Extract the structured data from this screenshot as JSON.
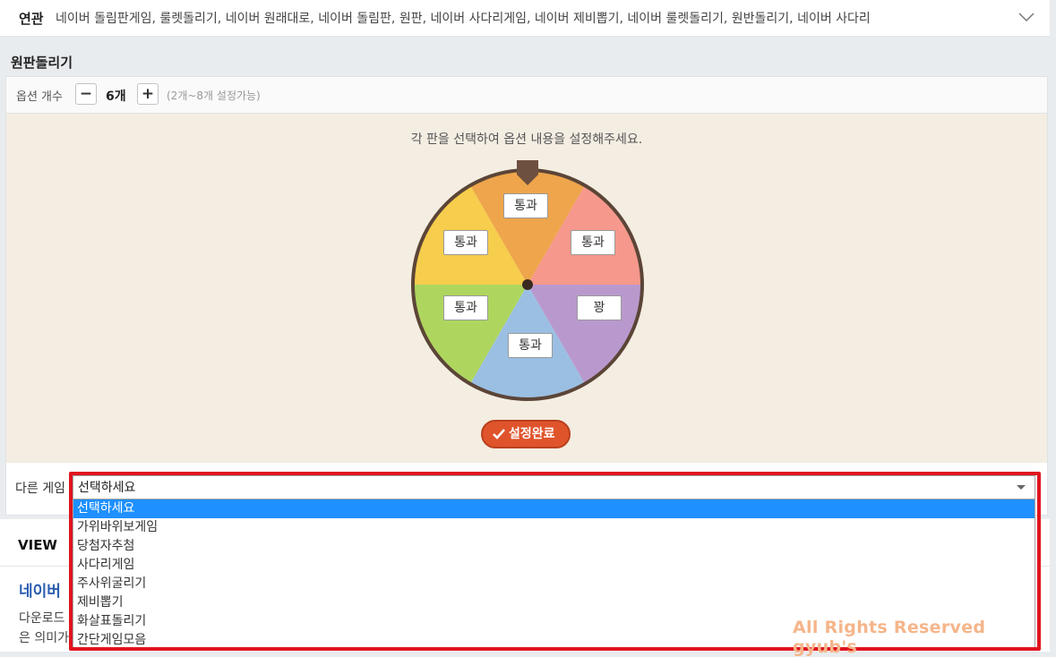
{
  "related": {
    "label": "연관",
    "keywords": "네이버 돌림판게임, 룰렛돌리기, 네이버 원래대로, 네이버 돌림판, 원판, 네이버 사다리게임, 네이버 제비뽑기, 네이버 룰렛돌리기, 원반돌리기, 네이버 사다리",
    "expand_icon": "chevron-down-icon"
  },
  "section_title": "원판돌리기",
  "options": {
    "label": "옵션 개수",
    "minus": "−",
    "plus": "+",
    "count": "6개",
    "range_hint": "(2개~8개 설정가능)"
  },
  "wheel": {
    "instruction": "각 판을 선택하여 옵션 내용을 설정해주세요.",
    "slices": [
      {
        "label": "통과",
        "color": "#eea54b"
      },
      {
        "label": "통과",
        "color": "#f6988c"
      },
      {
        "label": "꽝",
        "color": "#b999cd"
      },
      {
        "label": "통과",
        "color": "#9bbfe3"
      },
      {
        "label": "통과",
        "color": "#aed65f"
      },
      {
        "label": "통과",
        "color": "#f6cd4c"
      }
    ],
    "rim_color": "#5b4537",
    "pointer_color": "#6e5040"
  },
  "done_button": {
    "label": "설정완료",
    "icon": "check-icon",
    "color": "#e0542c"
  },
  "other_game": {
    "label": "다른 게임",
    "selected": "선택하세요",
    "options": [
      "선택하세요",
      "가위바위보게임",
      "당첨자추첨",
      "사다리게임",
      "주사위굴리기",
      "제비뽑기",
      "화살표돌리기",
      "간단게임모음"
    ]
  },
  "view": {
    "title": "VIEW",
    "blog_title": "네이버",
    "line1": "다운로드",
    "line2": "은 의미가"
  },
  "watermark": "All Rights Reserved gyub's",
  "highlight_color": "#e0141e"
}
